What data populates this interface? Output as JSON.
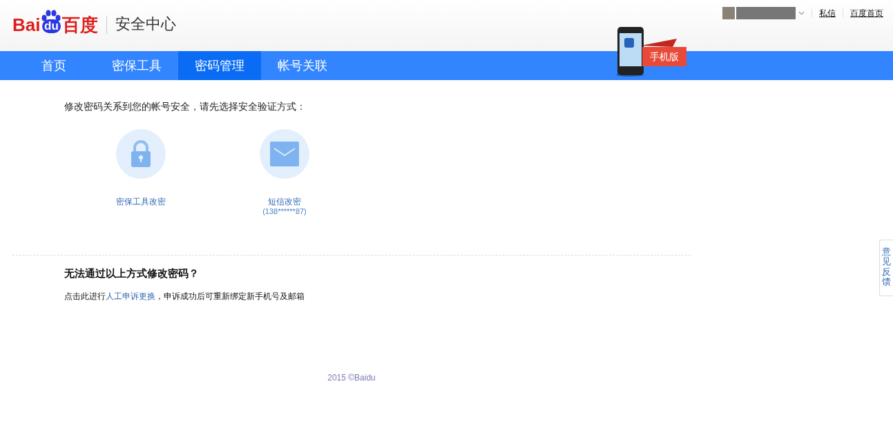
{
  "header": {
    "logo": {
      "part_1": "Bai",
      "part_2": "du",
      "part_3": "百度"
    },
    "site_title": "安全中心",
    "user_links": [
      "私信",
      "百度首页"
    ],
    "mobile_banner": "手机版"
  },
  "nav": {
    "tabs": [
      {
        "label": "首页",
        "selected": false
      },
      {
        "label": "密保工具",
        "selected": false
      },
      {
        "label": "密码管理",
        "selected": true
      },
      {
        "label": "帐号关联",
        "selected": false
      }
    ]
  },
  "content": {
    "intro": "修改密码关系到您的帐号安全，请先选择安全验证方式：",
    "methods": [
      {
        "kind": "lock",
        "label": "密保工具改密"
      },
      {
        "kind": "mail",
        "label": "短信改密",
        "detail": "(138******87)"
      }
    ],
    "help_title": "无法通过以上方式修改密码？",
    "help_before": "点击此进行",
    "help_link": "人工申诉更换",
    "help_after": "，申诉成功后可重新绑定新手机号及邮箱"
  },
  "footer": "2015 ©Baidu",
  "feedback_tab": "意见反馈"
}
